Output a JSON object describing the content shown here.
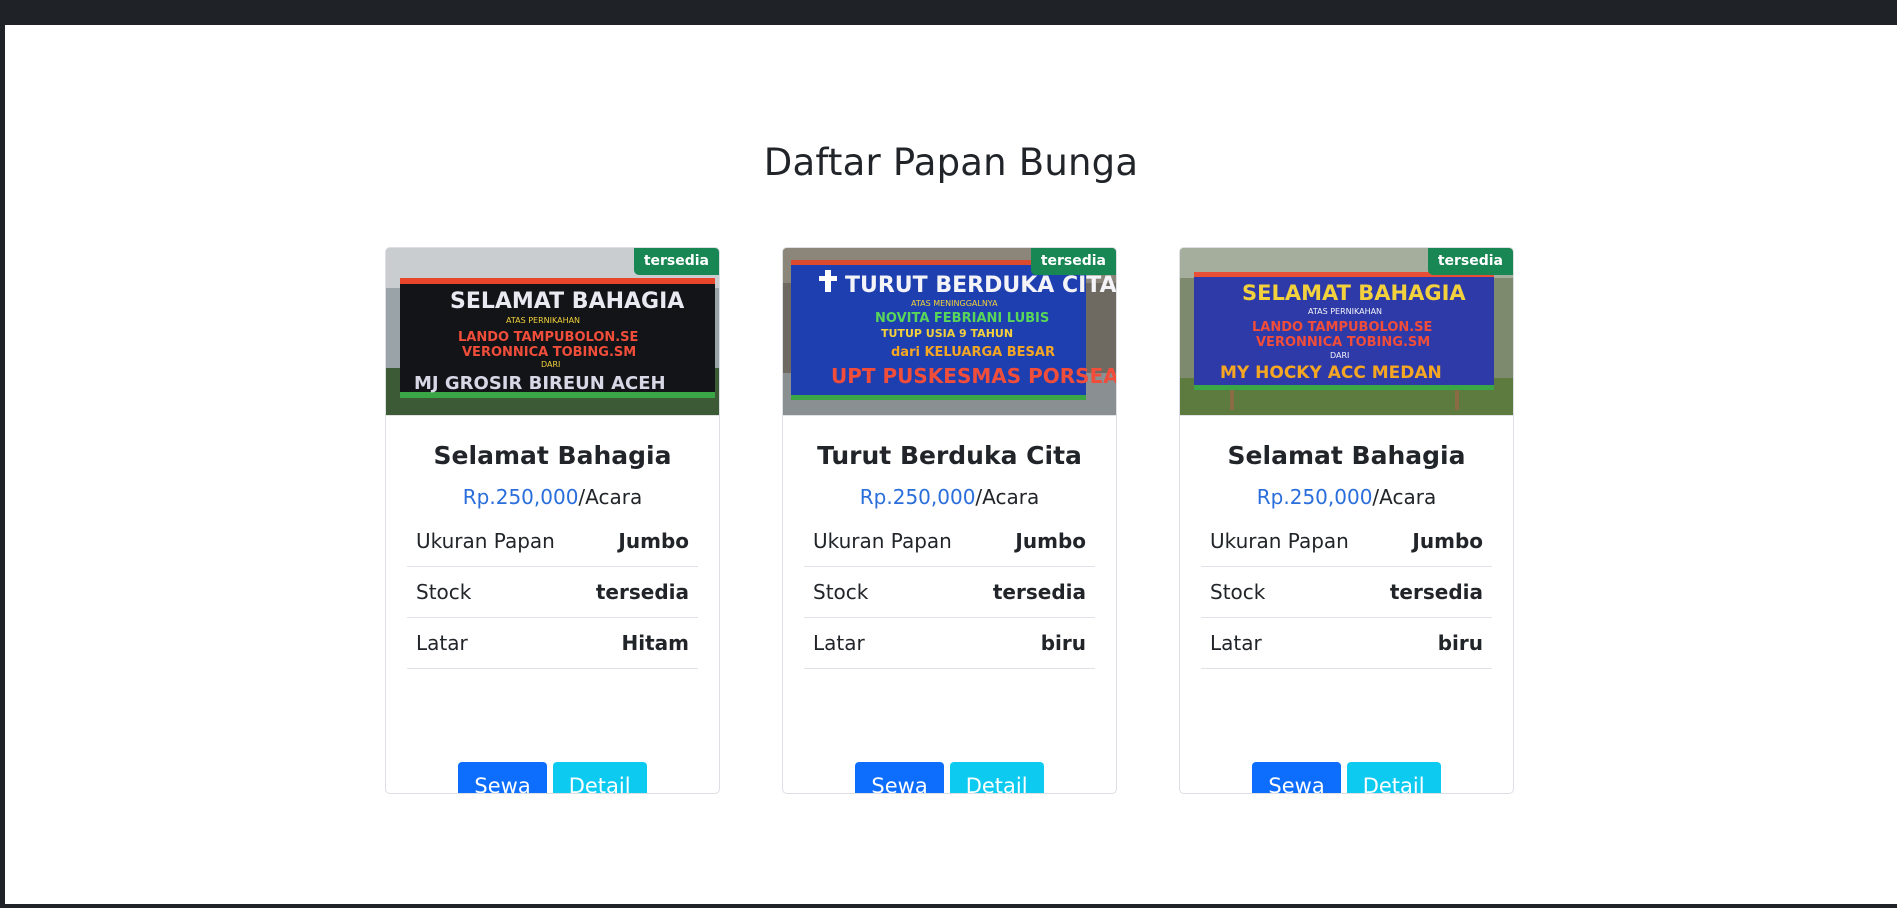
{
  "page": {
    "title": "Daftar Papan Bunga"
  },
  "cards": [
    {
      "badge": "tersedia",
      "title": "Selamat Bahagia",
      "price": "Rp.250,000",
      "price_unit": "/Acara",
      "specs": [
        {
          "label": "Ukuran Papan",
          "value": "Jumbo"
        },
        {
          "label": "Stock",
          "value": "tersedia"
        },
        {
          "label": "Latar",
          "value": "Hitam"
        }
      ],
      "rent_label": "Sewa",
      "detail_label": "Detail",
      "image": {
        "background": "#121418",
        "banner_lines": [
          "SELAMAT BAHAGIA",
          "ATAS PERNIKAHAN",
          "LANDO TAMPUBOLON.SE",
          "VERONNICA TOBING.SM",
          "DARI",
          "MJ GROSIR BIREUN ACEH"
        ]
      }
    },
    {
      "badge": "tersedia",
      "title": "Turut Berduka Cita",
      "price": "Rp.250,000",
      "price_unit": "/Acara",
      "specs": [
        {
          "label": "Ukuran Papan",
          "value": "Jumbo"
        },
        {
          "label": "Stock",
          "value": "tersedia"
        },
        {
          "label": "Latar",
          "value": "biru"
        }
      ],
      "rent_label": "Sewa",
      "detail_label": "Detail",
      "image": {
        "background": "#1d3fb0",
        "banner_lines": [
          "TURUT BERDUKA CITA",
          "ATAS MENINGGALNYA",
          "NOVITA FEBRIANI LUBIS",
          "TUTUP USIA 9 TAHUN",
          "dari KELUARGA BESAR",
          "UPT PUSKESMAS PORSEA"
        ]
      }
    },
    {
      "badge": "tersedia",
      "title": "Selamat Bahagia",
      "price": "Rp.250,000",
      "price_unit": "/Acara",
      "specs": [
        {
          "label": "Ukuran Papan",
          "value": "Jumbo"
        },
        {
          "label": "Stock",
          "value": "tersedia"
        },
        {
          "label": "Latar",
          "value": "biru"
        }
      ],
      "rent_label": "Sewa",
      "detail_label": "Detail",
      "image": {
        "background": "#2e3aa8",
        "banner_lines": [
          "SELAMAT BAHAGIA",
          "ATAS PERNIKAHAN",
          "LANDO TAMPUBOLON.SE",
          "VERONNICA TOBING.SM",
          "DARI",
          "MY HOCKY ACC MEDAN"
        ]
      }
    }
  ]
}
